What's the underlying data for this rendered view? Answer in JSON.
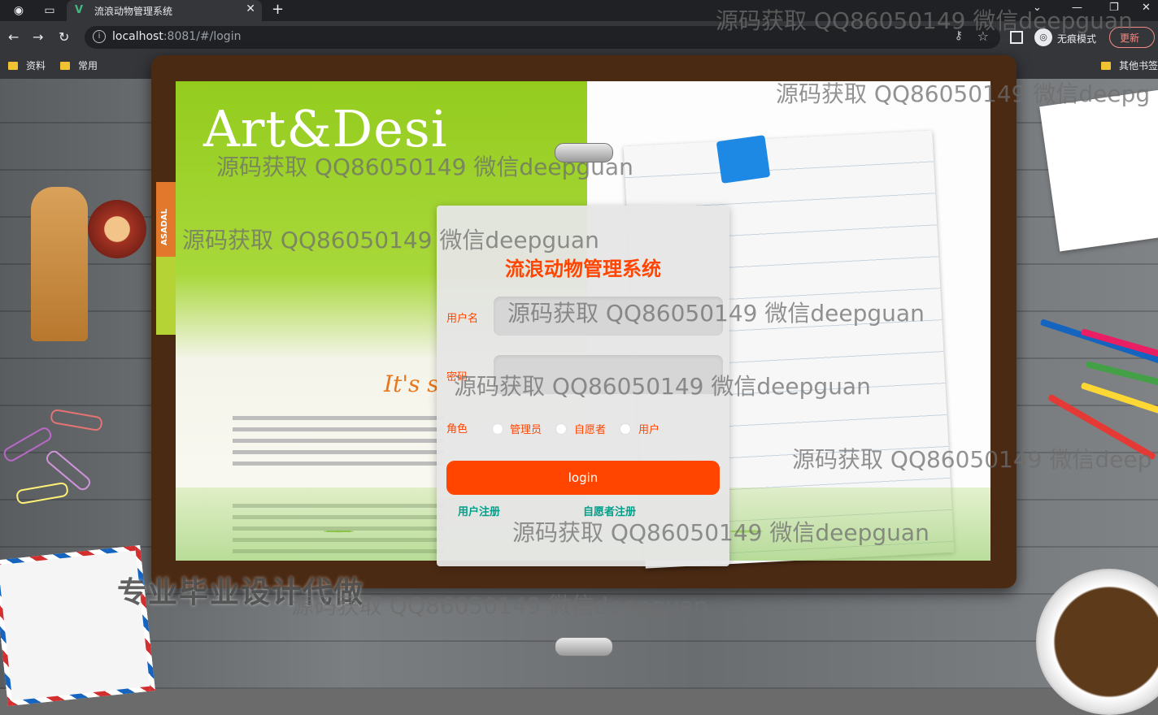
{
  "browser": {
    "tab_title": "流浪动物管理系统",
    "url_host": "localhost",
    "url_rest": ":8081/#/login",
    "incognito_label": "无痕模式",
    "update_label": "更新",
    "bookmarks": [
      "资料",
      "常用"
    ],
    "other_bookmarks": "其他书签"
  },
  "login": {
    "title": "流浪动物管理系统",
    "username_label": "用户名",
    "password_label": "密码",
    "role_label": "角色",
    "roles": [
      "管理员",
      "自愿者",
      "用户"
    ],
    "login_button": "login",
    "register_user": "用户注册",
    "register_volunteer": "自愿者注册"
  },
  "background": {
    "art_text": "Art&Desi",
    "its_text": "It's s",
    "tab_text": "ASADAL",
    "promo_text": "专业毕业设计代做"
  },
  "watermarks": [
    "源码获取 QQ86050149 微信deepguan",
    "源码获取 QQ86050149 微信deepguan",
    "源码获取 QQ86050149 微信deepguan",
    "源码获取 QQ86050149 微信deepguan",
    "源码获取 QQ86050149 微信deepguan",
    "源码获取 QQ86050149 微信deepguan",
    "源码获取 QQ86050149 微信deep",
    "源码获取 QQ86050149 微信deepguan",
    "源码获取 QQ86050149 微信deepg"
  ],
  "colors": {
    "accent": "#ff4500",
    "link": "#00a08a"
  }
}
